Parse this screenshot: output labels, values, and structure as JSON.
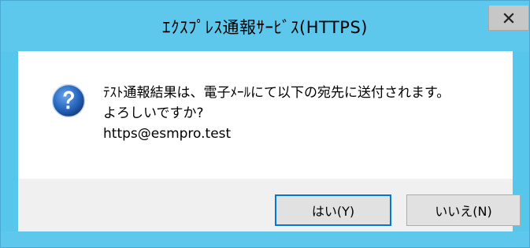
{
  "window": {
    "title": "ｴｸｽﾌﾟﾚｽ通報ｻｰﾋﾞｽ(HTTPS)",
    "close_glyph": "x"
  },
  "dialog": {
    "icon": "question-icon",
    "message_lines": [
      "ﾃｽﾄ通報結果は、電子ﾒｰﾙにて以下の宛先に送付されます。",
      "よろしいですか?",
      "https@esmpro.test"
    ]
  },
  "buttons": {
    "yes_label": "はい(Y)",
    "no_label": "いいえ(N)"
  },
  "colors": {
    "titlebar": "#5ec8ec",
    "button_face": "#e1e1e1",
    "focus_border": "#0078d7",
    "icon_blue": "#1f5fb0"
  }
}
